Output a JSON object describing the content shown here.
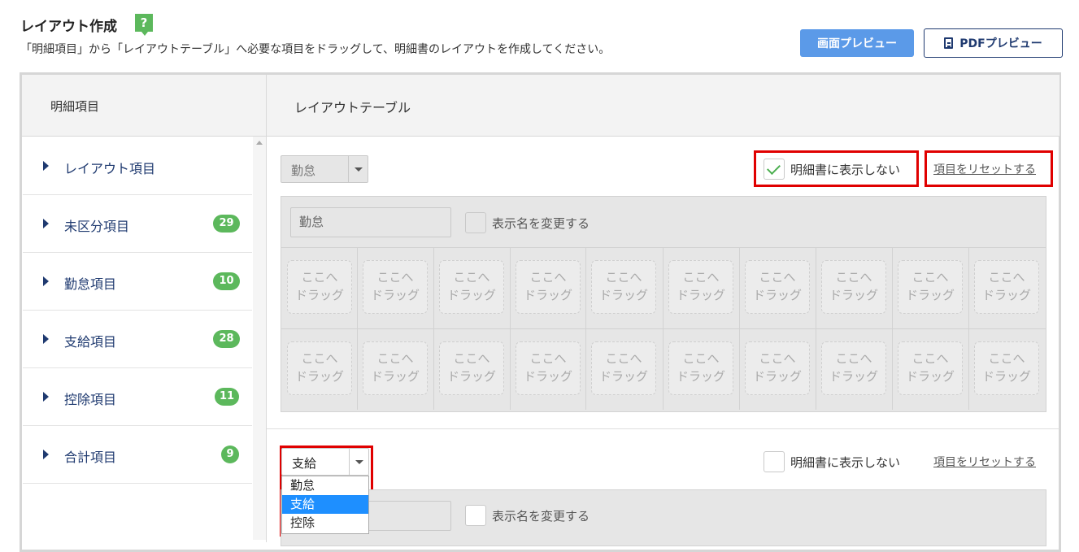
{
  "header": {
    "title": "レイアウト作成",
    "help": "?",
    "description": "「明細項目」から「レイアウトテーブル」へ必要な項目をドラッグして、明細書のレイアウトを作成してください。",
    "preview_label": "画面プレビュー",
    "pdf_label": "PDFプレビュー"
  },
  "left_panel": {
    "title": "明細項目",
    "items": [
      {
        "label": "レイアウト項目",
        "count": ""
      },
      {
        "label": "未区分項目",
        "count": "29"
      },
      {
        "label": "勤怠項目",
        "count": "10"
      },
      {
        "label": "支給項目",
        "count": "28"
      },
      {
        "label": "控除項目",
        "count": "11"
      },
      {
        "label": "合計項目",
        "count": "9"
      }
    ]
  },
  "right_panel": {
    "title": "レイアウトテーブル",
    "section1": {
      "category": "勤怠",
      "hide_label": "明細書に表示しない",
      "hide_checked": true,
      "reset_label": "項目をリセットする",
      "name_value": "勤怠",
      "rename_label": "表示名を変更する",
      "drop_line1": "ここへ",
      "drop_line2": "ドラッグ"
    },
    "section2": {
      "category": "支給",
      "hide_label": "明細書に表示しない",
      "hide_checked": false,
      "reset_label": "項目をリセットする",
      "rename_label": "表示名を変更する",
      "options": [
        "勤怠",
        "支給",
        "控除"
      ],
      "selected_option": "支給"
    }
  },
  "colors": {
    "accent_green": "#5cb85c",
    "primary_blue": "#5b9ae8",
    "navy": "#1f3a70",
    "highlight_red": "#e00000",
    "option_selected": "#1e8fff"
  }
}
